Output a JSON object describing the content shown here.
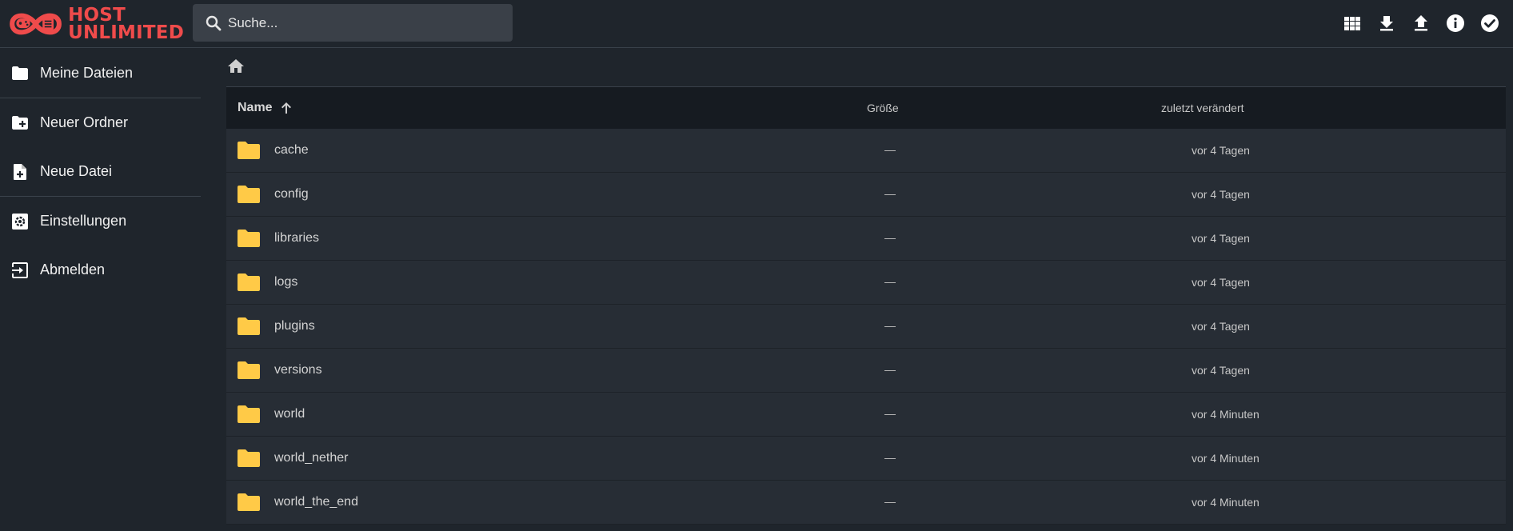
{
  "brand": {
    "line1": "HOST",
    "line2": "UNLIMITED",
    "color": "#ef4b4b"
  },
  "search": {
    "placeholder": "Suche..."
  },
  "header_actions": [
    {
      "name": "grid-view-icon"
    },
    {
      "name": "download-icon"
    },
    {
      "name": "upload-icon"
    },
    {
      "name": "info-icon"
    },
    {
      "name": "select-all-icon"
    }
  ],
  "sidebar": {
    "items": [
      {
        "label": "Meine Dateien",
        "icon": "folder-icon"
      },
      {
        "label": "Neuer Ordner",
        "icon": "new-folder-icon"
      },
      {
        "label": "Neue Datei",
        "icon": "new-file-icon"
      },
      {
        "label": "Einstellungen",
        "icon": "settings-icon"
      },
      {
        "label": "Abmelden",
        "icon": "logout-icon"
      }
    ]
  },
  "breadcrumb": {
    "icon": "home-icon"
  },
  "table": {
    "headers": {
      "name": "Name",
      "size": "Größe",
      "modified": "zuletzt verändert"
    },
    "rows": [
      {
        "name": "cache",
        "size": "—",
        "modified": "vor 4 Tagen"
      },
      {
        "name": "config",
        "size": "—",
        "modified": "vor 4 Tagen"
      },
      {
        "name": "libraries",
        "size": "—",
        "modified": "vor 4 Tagen"
      },
      {
        "name": "logs",
        "size": "—",
        "modified": "vor 4 Tagen"
      },
      {
        "name": "plugins",
        "size": "—",
        "modified": "vor 4 Tagen"
      },
      {
        "name": "versions",
        "size": "—",
        "modified": "vor 4 Tagen"
      },
      {
        "name": "world",
        "size": "—",
        "modified": "vor 4 Minuten"
      },
      {
        "name": "world_nether",
        "size": "—",
        "modified": "vor 4 Minuten"
      },
      {
        "name": "world_the_end",
        "size": "—",
        "modified": "vor 4 Minuten"
      }
    ]
  },
  "colors": {
    "folder": "#ffca47",
    "header_bg": "#1f252c",
    "row_bg": "#272d35"
  }
}
